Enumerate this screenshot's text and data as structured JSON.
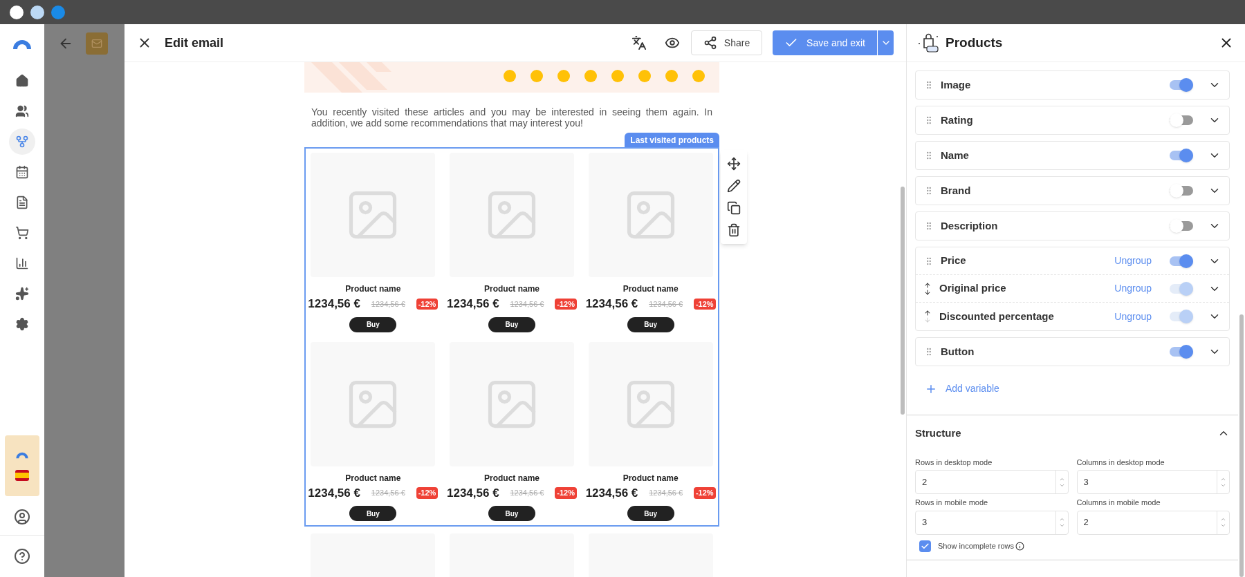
{
  "nav": {
    "items": [
      {
        "kind": "home",
        "selected": false
      },
      {
        "kind": "contacts",
        "selected": false
      },
      {
        "kind": "flows",
        "selected": true
      },
      {
        "kind": "calendar",
        "selected": false
      },
      {
        "kind": "documents",
        "selected": false
      },
      {
        "kind": "cart",
        "selected": false
      },
      {
        "kind": "reports",
        "selected": false
      },
      {
        "kind": "ai",
        "selected": false
      },
      {
        "kind": "settings",
        "selected": false
      }
    ]
  },
  "header": {
    "title": "Edit email",
    "share": "Share",
    "save": "Save and exit"
  },
  "email": {
    "intro": "You recently visited these articles and you may be interested in seeing them again. In addition, we add some recommendations that may interest you!",
    "block_label": "Last visited products",
    "products": [
      {
        "name": "Product name",
        "price": "1234,56 €",
        "original_price": "1234,56 €",
        "discount": "-12%",
        "button": "Buy"
      },
      {
        "name": "Product name",
        "price": "1234,56 €",
        "original_price": "1234,56 €",
        "discount": "-12%",
        "button": "Buy"
      },
      {
        "name": "Product name",
        "price": "1234,56 €",
        "original_price": "1234,56 €",
        "discount": "-12%",
        "button": "Buy"
      },
      {
        "name": "Product name",
        "price": "1234,56 €",
        "original_price": "1234,56 €",
        "discount": "-12%",
        "button": "Buy"
      },
      {
        "name": "Product name",
        "price": "1234,56 €",
        "original_price": "1234,56 €",
        "discount": "-12%",
        "button": "Buy"
      },
      {
        "name": "Product name",
        "price": "1234,56 €",
        "original_price": "1234,56 €",
        "discount": "-12%",
        "button": "Buy"
      }
    ]
  },
  "panel": {
    "title": "Products",
    "variables": [
      {
        "kind": "single",
        "label": "Image",
        "on": true
      },
      {
        "kind": "single",
        "label": "Rating",
        "on": false
      },
      {
        "kind": "single",
        "label": "Name",
        "on": true
      },
      {
        "kind": "single",
        "label": "Brand",
        "on": false
      },
      {
        "kind": "single",
        "label": "Description",
        "on": false
      },
      {
        "kind": "group",
        "items": [
          {
            "label": "Price",
            "action": "Ungroup",
            "on": true,
            "disabled": false
          },
          {
            "label": "Original price",
            "action": "Ungroup",
            "on": true,
            "disabled": true
          },
          {
            "label": "Discounted percentage",
            "action": "Ungroup",
            "on": true,
            "disabled": true
          }
        ]
      },
      {
        "kind": "single",
        "label": "Button",
        "on": true
      }
    ],
    "add_variable": "Add variable",
    "structure": {
      "title": "Structure",
      "expanded": true,
      "fields": [
        {
          "label": "Rows in desktop mode",
          "value": "2"
        },
        {
          "label": "Columns in desktop mode",
          "value": "3"
        },
        {
          "label": "Rows in mobile mode",
          "value": "3"
        },
        {
          "label": "Columns in mobile mode",
          "value": "2"
        }
      ],
      "show_incomplete": {
        "label": "Show incomplete rows",
        "checked": true
      }
    }
  }
}
